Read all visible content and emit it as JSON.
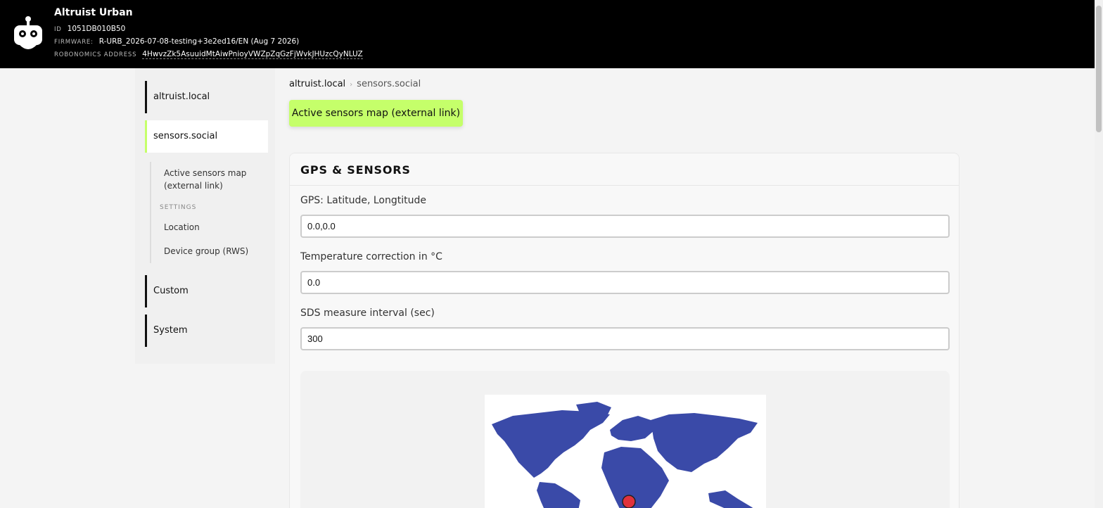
{
  "header": {
    "title": "Altruist Urban",
    "id_label": "ID",
    "id_value": "1051DB010B50",
    "firmware_label": "FIRMWARE:",
    "firmware_value": "R-URB_2026-07-08-testing+3e2ed16/EN (Aug 7 2026)",
    "address_label": "ROBONOMICS ADDRESS",
    "address_value": "4HwvzZk5AsuuidMtAiwPnioyVWZpZqGzFjWvkJHUzcQyNLUZ"
  },
  "sidebar": {
    "items": [
      {
        "label": "altruist.local"
      },
      {
        "label": "sensors.social"
      },
      {
        "label": "Custom"
      },
      {
        "label": "System"
      }
    ],
    "sub_items": {
      "map_line1": "Active sensors map",
      "map_line2": "(external link)",
      "settings_label": "SETTINGS",
      "location": "Location",
      "device_group": "Device group (RWS)"
    }
  },
  "breadcrumb": {
    "root": "altruist.local",
    "separator": "›",
    "current": "sensors.social"
  },
  "map_link": {
    "label": "Active sensors map (external link)"
  },
  "card": {
    "title": "GPS & SENSORS",
    "fields": [
      {
        "label": "GPS: Latitude, Longtitude",
        "value": "0.0,0.0"
      },
      {
        "label": "Temperature correction in °C",
        "value": "0.0"
      },
      {
        "label": "SDS measure interval (sec)",
        "value": "300"
      }
    ]
  },
  "colors": {
    "accent": "#c5ff6a",
    "header_bg": "#000000",
    "map_land": "#3a4aa8",
    "marker": "#e0323c"
  }
}
